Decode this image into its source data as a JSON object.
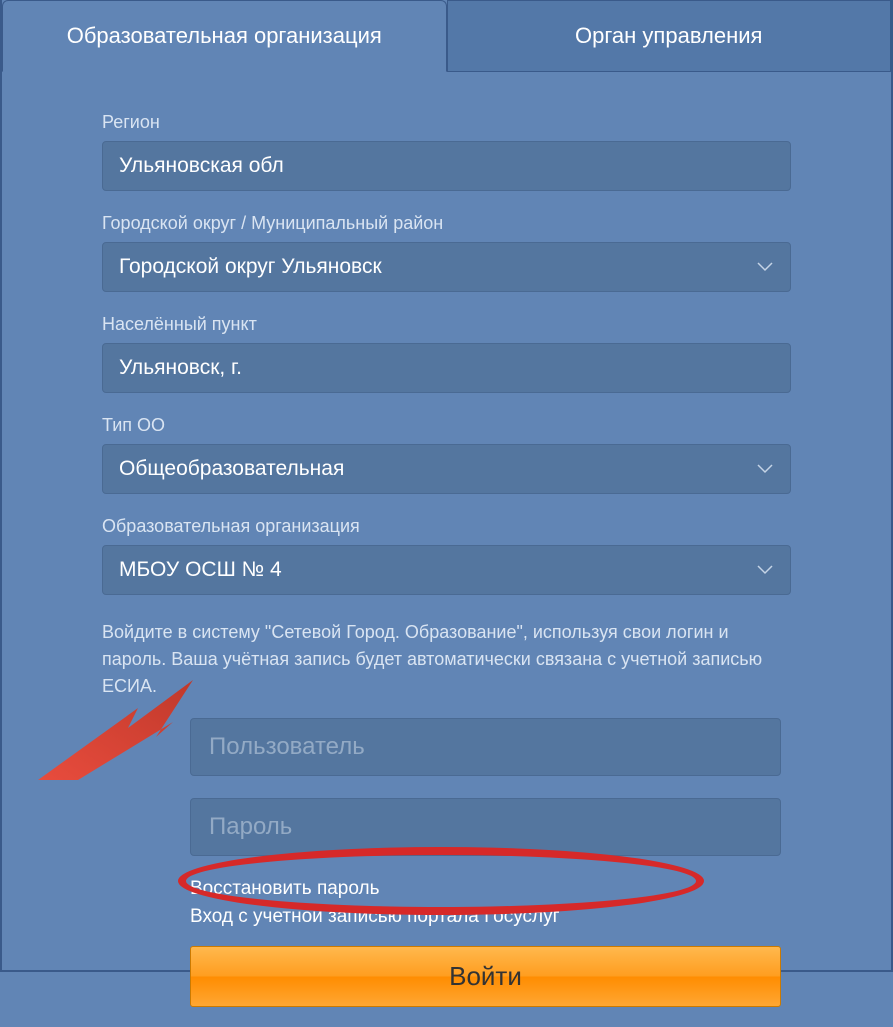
{
  "tabs": {
    "active": "Образовательная организация",
    "inactive": "Орган управления"
  },
  "fields": {
    "region": {
      "label": "Регион",
      "value": "Ульяновская обл"
    },
    "district": {
      "label": "Городской округ / Муниципальный район",
      "value": "Городской округ Ульяновск"
    },
    "settlement": {
      "label": "Населённый пункт",
      "value": "Ульяновск, г."
    },
    "orgtype": {
      "label": "Тип ОО",
      "value": "Общеобразовательная"
    },
    "org": {
      "label": "Образовательная организация",
      "value": "МБОУ ОСШ № 4"
    }
  },
  "info_text": "Войдите в систему \"Сетевой Город. Образование\", используя свои логин и пароль. Ваша учётная запись будет автоматически связана с учетной записью ЕСИА.",
  "credentials": {
    "user_placeholder": "Пользователь",
    "password_placeholder": "Пароль"
  },
  "links": {
    "recover": "Восстановить пароль",
    "gosuslugi": "Вход с учетной записью портала Госуслуг"
  },
  "login_button": "Войти"
}
